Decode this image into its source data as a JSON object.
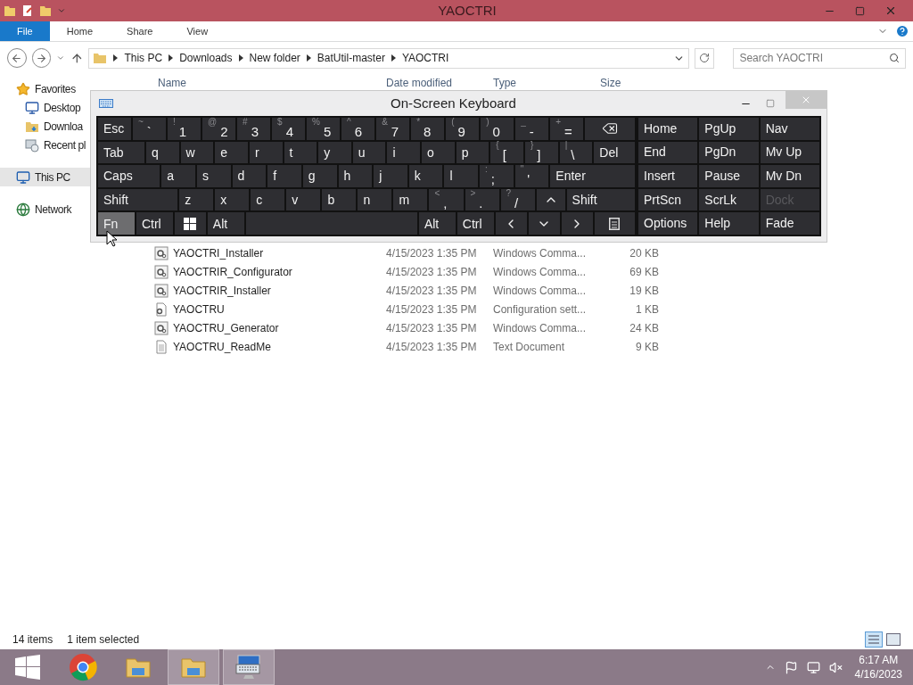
{
  "window": {
    "title": "YAOCTRI"
  },
  "ribbon_tabs": [
    {
      "label": "File",
      "selected": true
    },
    {
      "label": "Home",
      "selected": false
    },
    {
      "label": "Share",
      "selected": false
    },
    {
      "label": "View",
      "selected": false
    }
  ],
  "breadcrumbs": [
    "This PC",
    "Downloads",
    "New folder",
    "BatUtil-master",
    "YAOCTRI"
  ],
  "search": {
    "placeholder": "Search YAOCTRI"
  },
  "nav": [
    {
      "label": "Favorites",
      "kind": "favorites",
      "selected": false
    },
    {
      "label": "Desktop",
      "kind": "desktop",
      "selected": false
    },
    {
      "label": "Downloa",
      "kind": "downloads",
      "selected": false
    },
    {
      "label": "Recent pl",
      "kind": "recent",
      "selected": false
    },
    {
      "label": "This PC",
      "kind": "pc",
      "selected": true
    },
    {
      "label": "Network",
      "kind": "network",
      "selected": false
    }
  ],
  "columns": [
    "Name",
    "Date modified",
    "Type",
    "Size"
  ],
  "files": [
    {
      "name": "YAOCTRI_Installer",
      "date": "4/15/2023 1:35 PM",
      "type": "Windows Comma...",
      "size": "20 KB",
      "kind": "cmd"
    },
    {
      "name": "YAOCTRIR_Configurator",
      "date": "4/15/2023 1:35 PM",
      "type": "Windows Comma...",
      "size": "69 KB",
      "kind": "cmd"
    },
    {
      "name": "YAOCTRIR_Installer",
      "date": "4/15/2023 1:35 PM",
      "type": "Windows Comma...",
      "size": "19 KB",
      "kind": "cmd"
    },
    {
      "name": "YAOCTRU",
      "date": "4/15/2023 1:35 PM",
      "type": "Configuration sett...",
      "size": "1 KB",
      "kind": "ini"
    },
    {
      "name": "YAOCTRU_Generator",
      "date": "4/15/2023 1:35 PM",
      "type": "Windows Comma...",
      "size": "24 KB",
      "kind": "cmd"
    },
    {
      "name": "YAOCTRU_ReadMe",
      "date": "4/15/2023 1:35 PM",
      "type": "Text Document",
      "size": "9 KB",
      "kind": "txt"
    }
  ],
  "status": {
    "count": "14 items",
    "selection": "1 item selected"
  },
  "keyboard": {
    "title": "On-Screen Keyboard",
    "rows": [
      {
        "keys": [
          {
            "kind": "text",
            "label": "Esc",
            "hovered": false
          },
          {
            "kind": "text",
            "label": "`",
            "shift": "~",
            "hovered": false
          },
          {
            "kind": "text",
            "label": "1",
            "shift": "!",
            "hovered": false
          },
          {
            "kind": "text",
            "label": "2",
            "shift": "@",
            "hovered": false
          },
          {
            "kind": "text",
            "label": "3",
            "shift": "#",
            "hovered": false
          },
          {
            "kind": "text",
            "label": "4",
            "shift": "$",
            "hovered": false
          },
          {
            "kind": "text",
            "label": "5",
            "shift": "%",
            "hovered": false
          },
          {
            "kind": "text",
            "label": "6",
            "shift": "^",
            "hovered": false
          },
          {
            "kind": "text",
            "label": "7",
            "shift": "&",
            "hovered": false
          },
          {
            "kind": "text",
            "label": "8",
            "shift": "*",
            "hovered": false
          },
          {
            "kind": "text",
            "label": "9",
            "shift": "(",
            "hovered": false
          },
          {
            "kind": "text",
            "label": "0",
            "shift": ")",
            "hovered": false
          },
          {
            "kind": "text",
            "label": "-",
            "shift": "_",
            "hovered": false
          },
          {
            "kind": "text",
            "label": "=",
            "shift": "+",
            "hovered": false
          },
          {
            "kind": "backspace",
            "hovered": false
          }
        ]
      },
      {
        "keys": [
          {
            "kind": "text",
            "label": "Tab",
            "hovered": false
          },
          {
            "kind": "text",
            "label": "q",
            "hovered": false
          },
          {
            "kind": "text",
            "label": "w",
            "hovered": false
          },
          {
            "kind": "text",
            "label": "e",
            "hovered": false
          },
          {
            "kind": "text",
            "label": "r",
            "hovered": false
          },
          {
            "kind": "text",
            "label": "t",
            "hovered": false
          },
          {
            "kind": "text",
            "label": "y",
            "hovered": false
          },
          {
            "kind": "text",
            "label": "u",
            "hovered": false
          },
          {
            "kind": "text",
            "label": "i",
            "hovered": false
          },
          {
            "kind": "text",
            "label": "o",
            "hovered": false
          },
          {
            "kind": "text",
            "label": "p",
            "hovered": false
          },
          {
            "kind": "text",
            "label": "[",
            "shift": "{",
            "hovered": false
          },
          {
            "kind": "text",
            "label": "]",
            "shift": "}",
            "hovered": false
          },
          {
            "kind": "text",
            "label": "\\",
            "shift": "|",
            "hovered": false
          },
          {
            "kind": "text",
            "label": "Del",
            "hovered": false
          }
        ]
      },
      {
        "keys": [
          {
            "kind": "text",
            "label": "Caps",
            "hovered": false
          },
          {
            "kind": "text",
            "label": "a",
            "hovered": false
          },
          {
            "kind": "text",
            "label": "s",
            "hovered": false
          },
          {
            "kind": "text",
            "label": "d",
            "hovered": false
          },
          {
            "kind": "text",
            "label": "f",
            "hovered": false
          },
          {
            "kind": "text",
            "label": "g",
            "hovered": false
          },
          {
            "kind": "text",
            "label": "h",
            "hovered": false
          },
          {
            "kind": "text",
            "label": "j",
            "hovered": false
          },
          {
            "kind": "text",
            "label": "k",
            "hovered": false
          },
          {
            "kind": "text",
            "label": "l",
            "hovered": false
          },
          {
            "kind": "text",
            "label": ";",
            "shift": ":",
            "hovered": false
          },
          {
            "kind": "text",
            "label": "'",
            "shift": "\"",
            "hovered": false
          },
          {
            "kind": "text",
            "label": "Enter",
            "hovered": false
          }
        ]
      },
      {
        "keys": [
          {
            "kind": "text",
            "label": "Shift",
            "hovered": false
          },
          {
            "kind": "text",
            "label": "z",
            "hovered": false
          },
          {
            "kind": "text",
            "label": "x",
            "hovered": false
          },
          {
            "kind": "text",
            "label": "c",
            "hovered": false
          },
          {
            "kind": "text",
            "label": "v",
            "hovered": false
          },
          {
            "kind": "text",
            "label": "b",
            "hovered": false
          },
          {
            "kind": "text",
            "label": "n",
            "hovered": false
          },
          {
            "kind": "text",
            "label": "m",
            "hovered": false
          },
          {
            "kind": "text",
            "label": ",",
            "shift": "<",
            "hovered": false
          },
          {
            "kind": "text",
            "label": ".",
            "shift": ">",
            "hovered": false
          },
          {
            "kind": "text",
            "label": "/",
            "shift": "?",
            "hovered": false
          },
          {
            "kind": "up",
            "hovered": false
          },
          {
            "kind": "text",
            "label": "Shift",
            "hovered": false
          }
        ]
      },
      {
        "keys": [
          {
            "kind": "text",
            "label": "Fn",
            "hovered": true
          },
          {
            "kind": "text",
            "label": "Ctrl",
            "hovered": false
          },
          {
            "kind": "windows",
            "hovered": false
          },
          {
            "kind": "text",
            "label": "Alt",
            "hovered": false
          },
          {
            "kind": "space",
            "hovered": false
          },
          {
            "kind": "text",
            "label": "Alt",
            "hovered": false
          },
          {
            "kind": "text",
            "label": "Ctrl",
            "hovered": false
          },
          {
            "kind": "left",
            "hovered": false
          },
          {
            "kind": "down",
            "hovered": false
          },
          {
            "kind": "right",
            "hovered": false
          },
          {
            "kind": "menu",
            "hovered": false
          }
        ]
      }
    ],
    "side_keys": [
      {
        "label": "Home",
        "disabled": false
      },
      {
        "label": "PgUp",
        "disabled": false
      },
      {
        "label": "Nav",
        "disabled": false
      },
      {
        "label": "End",
        "disabled": false
      },
      {
        "label": "PgDn",
        "disabled": false
      },
      {
        "label": "Mv Up",
        "disabled": false
      },
      {
        "label": "Insert",
        "disabled": false
      },
      {
        "label": "Pause",
        "disabled": false
      },
      {
        "label": "Mv Dn",
        "disabled": false
      },
      {
        "label": "PrtScn",
        "disabled": false
      },
      {
        "label": "ScrLk",
        "disabled": false
      },
      {
        "label": "Dock",
        "disabled": true
      },
      {
        "label": "Options",
        "disabled": false
      },
      {
        "label": "Help",
        "disabled": false
      },
      {
        "label": "Fade",
        "disabled": false
      }
    ]
  },
  "taskbar": [
    {
      "kind": "start",
      "active": false
    },
    {
      "kind": "chrome",
      "active": false
    },
    {
      "kind": "explorer",
      "active": false
    },
    {
      "kind": "explorer",
      "active": true
    },
    {
      "kind": "keyboard",
      "active": true
    }
  ],
  "clock": {
    "time": "6:17 AM",
    "date": "4/16/2023"
  }
}
